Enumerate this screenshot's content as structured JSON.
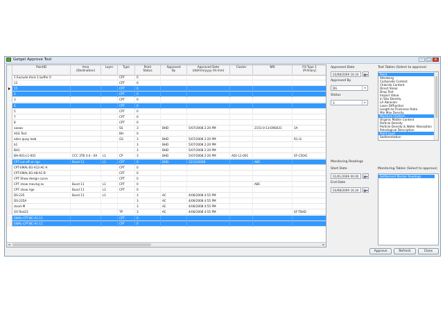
{
  "window": {
    "title": "Getgel Approve Tool",
    "buttons": [
      "–",
      "□",
      "×"
    ]
  },
  "grid": {
    "columns": [
      {
        "key": "point",
        "label": "PointID"
      },
      {
        "key": "area",
        "label": "Area\n(Destination)"
      },
      {
        "key": "layer",
        "label": "Layer"
      },
      {
        "key": "type",
        "label": "Type"
      },
      {
        "key": "status",
        "label": "Point\nStatus"
      },
      {
        "key": "by",
        "label": "Approved\nBy"
      },
      {
        "key": "date",
        "label": "Approved Date\n(dd/mm/yyyy hh:mm)"
      },
      {
        "key": "cluster",
        "label": "Cluster"
      },
      {
        "key": "nri",
        "label": "NRI"
      },
      {
        "key": "fill",
        "label": "Fill Type 1\n(Primary)"
      }
    ],
    "rows": [
      {
        "sel": false,
        "current": false,
        "point": "1 Exclude thick 1 buffer 0",
        "area": "",
        "layer": "",
        "type": "CPT",
        "status": "0",
        "by": "",
        "date": "",
        "cluster": "",
        "nri": "",
        "fill": ""
      },
      {
        "sel": false,
        "current": false,
        "point": "12",
        "area": "",
        "layer": "",
        "type": "CPT",
        "status": "0",
        "by": "",
        "date": "",
        "cluster": "",
        "nri": "",
        "fill": ""
      },
      {
        "sel": true,
        "current": true,
        "point": "15",
        "area": "",
        "layer": "",
        "type": "CPT",
        "status": "0",
        "by": "",
        "date": "",
        "cluster": "",
        "nri": "",
        "fill": ""
      },
      {
        "sel": true,
        "current": false,
        "point": "2",
        "area": "",
        "layer": "",
        "type": "CPT",
        "status": "0",
        "by": "",
        "date": "",
        "cluster": "",
        "nri": "",
        "fill": ""
      },
      {
        "sel": false,
        "current": false,
        "point": "3",
        "area": "",
        "layer": "",
        "type": "CPT",
        "status": "0",
        "by": "",
        "date": "",
        "cluster": "",
        "nri": "",
        "fill": ""
      },
      {
        "sel": true,
        "current": false,
        "point": "4",
        "area": "",
        "layer": "",
        "type": "CPT",
        "status": "0",
        "by": "",
        "date": "",
        "cluster": "",
        "nri": "",
        "fill": ""
      },
      {
        "sel": false,
        "current": false,
        "point": "5",
        "area": "",
        "layer": "",
        "type": "CPT",
        "status": "0",
        "by": "",
        "date": "",
        "cluster": "",
        "nri": "",
        "fill": ""
      },
      {
        "sel": false,
        "current": false,
        "point": "7",
        "area": "",
        "layer": "",
        "type": "CPT",
        "status": "0",
        "by": "",
        "date": "",
        "cluster": "",
        "nri": "",
        "fill": ""
      },
      {
        "sel": false,
        "current": false,
        "point": "8",
        "area": "",
        "layer": "",
        "type": "CPT",
        "status": "0",
        "by": "",
        "date": "",
        "cluster": "",
        "nri": "",
        "fill": ""
      },
      {
        "sel": false,
        "current": false,
        "point": "aaaaa",
        "area": "",
        "layer": "",
        "type": "SS",
        "status": "3",
        "by": "BHD",
        "date": "5/07/2008 2:20 PM",
        "cluster": "",
        "nri": "2151-0-13-ENS031",
        "fill": "1A"
      },
      {
        "sel": false,
        "current": false,
        "point": "AGS Test",
        "area": "",
        "layer": "",
        "type": "BH",
        "status": "0",
        "by": "",
        "date": "",
        "cluster": "",
        "nri": "",
        "fill": ""
      },
      {
        "sel": false,
        "current": false,
        "point": "aklor quay leeb",
        "area": "",
        "layer": "",
        "type": "GS",
        "status": "3",
        "by": "BHD",
        "date": "5/07/2008 2:20 PM",
        "cluster": "",
        "nri": "",
        "fill": "R1-3i"
      },
      {
        "sel": false,
        "current": false,
        "point": "b1",
        "area": "",
        "layer": "",
        "type": "",
        "status": "3",
        "by": "BHD",
        "date": "5/07/2008 2:20 PM",
        "cluster": "",
        "nri": "",
        "fill": ""
      },
      {
        "sel": false,
        "current": false,
        "point": "BH1",
        "area": "",
        "layer": "",
        "type": "",
        "status": "3",
        "by": "BHD",
        "date": "5/07/2008 2:20 PM",
        "cluster": "",
        "nri": "",
        "fill": ""
      },
      {
        "sel": false,
        "current": false,
        "point": "BH-A01-L1-001",
        "area": "CCC 3TB 3-4 - XA",
        "layer": "L1",
        "type": "CP",
        "status": "3",
        "by": "BHD",
        "date": "5/07/2008 2:20 PM",
        "cluster": "A01-L1-001",
        "nri": "",
        "fill": "SF-C50/G"
      },
      {
        "sel": true,
        "current": false,
        "point": "CPT-cut-off at rige",
        "area": "Bund 11",
        "layer": "L1",
        "type": "CPT",
        "status": "0",
        "by": "BHD",
        "date": "12/12/2008",
        "cluster": "",
        "nri": "ABC",
        "fill": ""
      },
      {
        "sel": false,
        "current": false,
        "point": "CPT-EMAL-B1-A12-AC-A",
        "area": "",
        "layer": "",
        "type": "CPT",
        "status": "0",
        "by": "",
        "date": "",
        "cluster": "",
        "nri": "",
        "fill": ""
      },
      {
        "sel": false,
        "current": false,
        "point": "CPT-EMAL-B1-A8-AC-B",
        "area": "",
        "layer": "",
        "type": "CPT",
        "status": "0",
        "by": "",
        "date": "",
        "cluster": "",
        "nri": "",
        "fill": ""
      },
      {
        "sel": false,
        "current": false,
        "point": "CPT Show design curve",
        "area": "",
        "layer": "",
        "type": "CPT",
        "status": "0",
        "by": "",
        "date": "",
        "cluster": "",
        "nri": "",
        "fill": ""
      },
      {
        "sel": false,
        "current": false,
        "point": "CPT show moving av",
        "area": "Bund 11",
        "layer": "L1",
        "type": "CPT",
        "status": "0",
        "by": "",
        "date": "",
        "cluster": "",
        "nri": "ABC",
        "fill": ""
      },
      {
        "sel": false,
        "current": false,
        "point": "CPT show rige",
        "area": "Bund 11",
        "layer": "L1",
        "type": "CPT",
        "status": "0",
        "by": "",
        "date": "",
        "cluster": "",
        "nri": "",
        "fill": ""
      },
      {
        "sel": false,
        "current": false,
        "point": "DS-235",
        "area": "Bund 11",
        "layer": "L1",
        "type": "",
        "status": "3",
        "by": "AC",
        "date": "4/06/2008 4:55 PM",
        "cluster": "",
        "nri": "",
        "fill": ""
      },
      {
        "sel": false,
        "current": false,
        "point": "DS-235A",
        "area": "",
        "layer": "",
        "type": "",
        "status": "3",
        "by": "AC",
        "date": "4/06/2008 4:55 PM",
        "cluster": "",
        "nri": "",
        "fill": ""
      },
      {
        "sel": false,
        "current": false,
        "point": "dsset M",
        "area": "",
        "layer": "",
        "type": "",
        "status": "3",
        "by": "AC",
        "date": "4/06/2008 4:55 PM",
        "cluster": "",
        "nri": "",
        "fill": ""
      },
      {
        "sel": false,
        "current": false,
        "point": "GS-Test23",
        "area": "",
        "layer": "",
        "type": "TP",
        "status": "3",
        "by": "AC",
        "date": "4/06/2008 4:55 PM",
        "cluster": "",
        "nri": "",
        "fill": "SF-TSHD"
      },
      {
        "sel": true,
        "current": false,
        "point": "SWAL-CPT-BC-A1-11",
        "area": "",
        "layer": "",
        "type": "CPT",
        "status": "0",
        "by": "",
        "date": "",
        "cluster": "",
        "nri": "",
        "fill": ""
      },
      {
        "sel": true,
        "current": false,
        "point": "SWAL-CPT-BC-A1-11",
        "area": "",
        "layer": "",
        "type": "CPT",
        "status": "0",
        "by": "",
        "date": "",
        "cluster": "",
        "nri": "",
        "fill": ""
      }
    ],
    "scroll_left": "◄",
    "scroll_right": "►"
  },
  "side": {
    "approved_date_label": "Approved Date",
    "approved_date_value": "03/08/2009 16:24",
    "approved_by_label": "Approved By",
    "approved_by_value": "DG",
    "status_label": "Status",
    "status_value": "3",
    "monitoring_label": "Monitoring Readings",
    "start_date_label": "Start Date",
    "start_date_value": "01/01/2009 00:00",
    "end_date_label": "End Date",
    "end_date_value": "03/08/2009 16:24",
    "test_tables_label": "Test Tables (Select to approve)",
    "test_tables": [
      {
        "label": "Point",
        "sel": true
      },
      {
        "label": "Atterberg",
        "sel": false
      },
      {
        "label": "Carbonate Content",
        "sel": false
      },
      {
        "label": "Chloride Content",
        "sel": false
      },
      {
        "label": "Direct Shear",
        "sel": false
      },
      {
        "label": "Drop Test",
        "sel": false
      },
      {
        "label": "Impact Value",
        "sel": false
      },
      {
        "label": "In Situ Density",
        "sel": false
      },
      {
        "label": "LA Abrasion",
        "sel": false
      },
      {
        "label": "Laser Diffraction",
        "sel": false
      },
      {
        "label": "Length-to-Thickness Ratio",
        "sel": false
      },
      {
        "label": "Min Max Density",
        "sel": false
      },
      {
        "label": "Moisture Content",
        "sel": true
      },
      {
        "label": "Organic Matter Content",
        "sel": false
      },
      {
        "label": "Particle Density",
        "sel": false
      },
      {
        "label": "Particle Density & Water Absorption",
        "sel": false
      },
      {
        "label": "Petrological Description",
        "sel": false
      },
      {
        "label": "Point Load",
        "sel": true
      },
      {
        "label": "Sedimentation",
        "sel": false
      }
    ],
    "monitoring_tables_label": "Monitoring Tables (Select to approve)",
    "monitoring_tables": [
      {
        "label": "Settlement Marker Readings",
        "sel": true
      }
    ]
  },
  "buttons": {
    "approve": "Approve",
    "refresh": "Refresh",
    "close": "Close"
  },
  "icons": {
    "calendar": "▦▾",
    "dropdown": "▾"
  }
}
